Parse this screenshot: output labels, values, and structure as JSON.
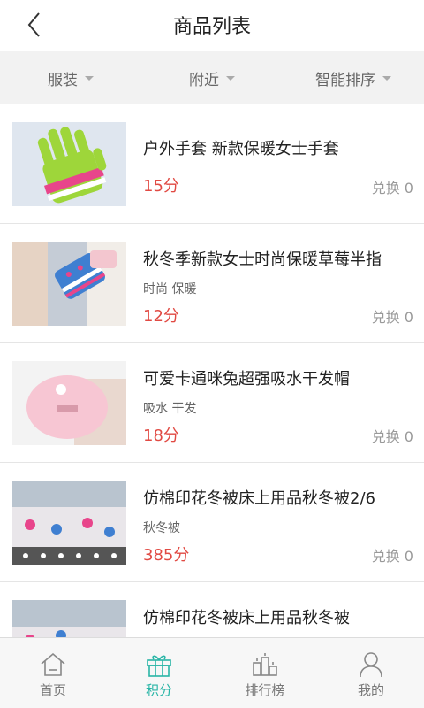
{
  "header": {
    "title": "商品列表"
  },
  "filters": [
    {
      "label": "服装"
    },
    {
      "label": "附近"
    },
    {
      "label": "智能排序"
    }
  ],
  "products": [
    {
      "title": "户外手套 新款保暖女士手套",
      "tags": "",
      "price": "15分",
      "redeem": "兑换 0",
      "image_icon": "gloves-image"
    },
    {
      "title": "秋冬季新款女士时尚保暖草莓半指",
      "tags": "时尚 保暖",
      "price": "12分",
      "redeem": "兑换 0",
      "image_icon": "fingerless-gloves-image"
    },
    {
      "title": "可爱卡通咪兔超强吸水干发帽",
      "tags": "吸水 干发",
      "price": "18分",
      "redeem": "兑换 0",
      "image_icon": "hair-cap-image"
    },
    {
      "title": "仿棉印花冬被床上用品秋冬被2/6",
      "tags": "秋冬被",
      "price": "385分",
      "redeem": "兑换 0",
      "image_icon": "quilt-image"
    },
    {
      "title": "仿棉印花冬被床上用品秋冬被",
      "tags": "",
      "price": "",
      "redeem": "",
      "image_icon": "quilt-image"
    }
  ],
  "tabbar": {
    "items": [
      {
        "label": "首页",
        "icon": "home-icon",
        "active": false
      },
      {
        "label": "积分",
        "icon": "gift-icon",
        "active": true
      },
      {
        "label": "排行榜",
        "icon": "ranking-icon",
        "active": false
      },
      {
        "label": "我的",
        "icon": "user-icon",
        "active": false
      }
    ]
  },
  "colors": {
    "accent": "#28b5a6",
    "price": "#e14a43"
  }
}
